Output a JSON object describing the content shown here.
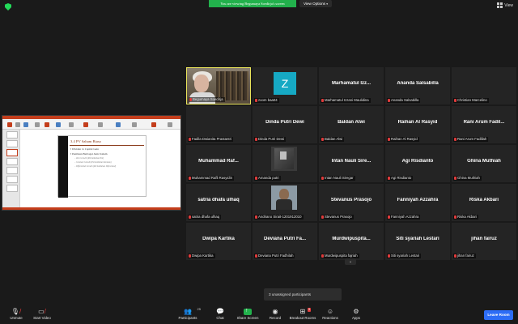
{
  "header": {
    "banner": "You are viewing Begumaya Soedirja's screen",
    "view_options": "View Options",
    "view": "View"
  },
  "slide": {
    "title": "3.4   PV Saham Biasa",
    "bullets": [
      "Dividen vs Capital Gain",
      "Penilaian Berbagai Jenis Saham"
    ],
    "sub_bullets": [
      "Zero Growth (Pertumbuhan Nol)",
      "Constant Growth (Pertumbuhan Konstan)",
      "Differential Growth (Pertumbuhan Diferensial)"
    ]
  },
  "tiles": [
    {
      "label": "Begumaya Soedirja",
      "big": "",
      "kind": "self"
    },
    {
      "label": "zoom baa04",
      "big": "",
      "kind": "avatar",
      "avatar_letter": "Z"
    },
    {
      "label": "Marhamatul Izzani Maulidina",
      "big": "Marhamatul  Izz..."
    },
    {
      "label": "Ananda Salsabilla",
      "big": "Ananda Salsabilla"
    },
    {
      "label": "Christian Marcelino",
      "big": ""
    },
    {
      "label": "Fadila Dwianita Prastantri",
      "big": ""
    },
    {
      "label": "Dinda Putri Dewi",
      "big": "Dinda Putri Dewi"
    },
    {
      "label": "Baldan Alwi",
      "big": "Baldan Alwi"
    },
    {
      "label": "Raihan Al Rasyid",
      "big": "Raihan Al Rasyid"
    },
    {
      "label": "Rani Arum Fadillah",
      "big": "Rani Arum Fadil..."
    },
    {
      "label": "Muhammad Rafli Rasyidin",
      "big": "Muhammad  Raf..."
    },
    {
      "label": "Amanda putri",
      "big": "",
      "kind": "photo-amanda"
    },
    {
      "label": "Intan Nauli Siregar",
      "big": "Intan Nauli Sire..."
    },
    {
      "label": "Agi Risdianto",
      "big": "Agi Risdianto"
    },
    {
      "label": "Ghina Muthiah",
      "big": "Ghina Muthiah"
    },
    {
      "label": "satria dhafa ulhaq",
      "big": "satria dhafa ulhaq"
    },
    {
      "label": "Andriano Sirait-1201912010",
      "big": "",
      "kind": "photo-andri"
    },
    {
      "label": "Stevanus Prasojo",
      "big": "Stevanus Prasojo"
    },
    {
      "label": "Fanniyah Azzahra",
      "big": "Fanniyah Azzahra"
    },
    {
      "label": "Riska Akbari",
      "big": "Riska Akbari"
    },
    {
      "label": "Dwipa Kartika",
      "big": "Dwipa Kartika"
    },
    {
      "label": "Deviana Putri Fadhilah",
      "big": "Deviana Putri Fa..."
    },
    {
      "label": "Murdwipuspita fajriah",
      "big": "Murdwipuspita..."
    },
    {
      "label": "Siti syariah Lestari",
      "big": "Siti syariah Lestari"
    },
    {
      "label": "jihan fairuz",
      "big": "jihan fairuz"
    }
  ],
  "unassigned": "3 unassigned participants",
  "toolbar": {
    "unmute": "Unmute",
    "start_video": "Start Video",
    "participants": "Participants",
    "participants_count": "25",
    "chat": "Chat",
    "share_screen": "Share Screen",
    "record": "Record",
    "breakout_rooms": "Breakout Rooms",
    "breakout_badge": "3",
    "reactions": "Reactions",
    "apps": "Apps",
    "leave": "Leave Room"
  },
  "colors": {
    "banner_green": "#22b14c",
    "active_speaker": "#e8e35a",
    "leave_blue": "#2d6df6",
    "muted_red": "#e03b3b",
    "avatar_teal": "#16a9c4"
  }
}
